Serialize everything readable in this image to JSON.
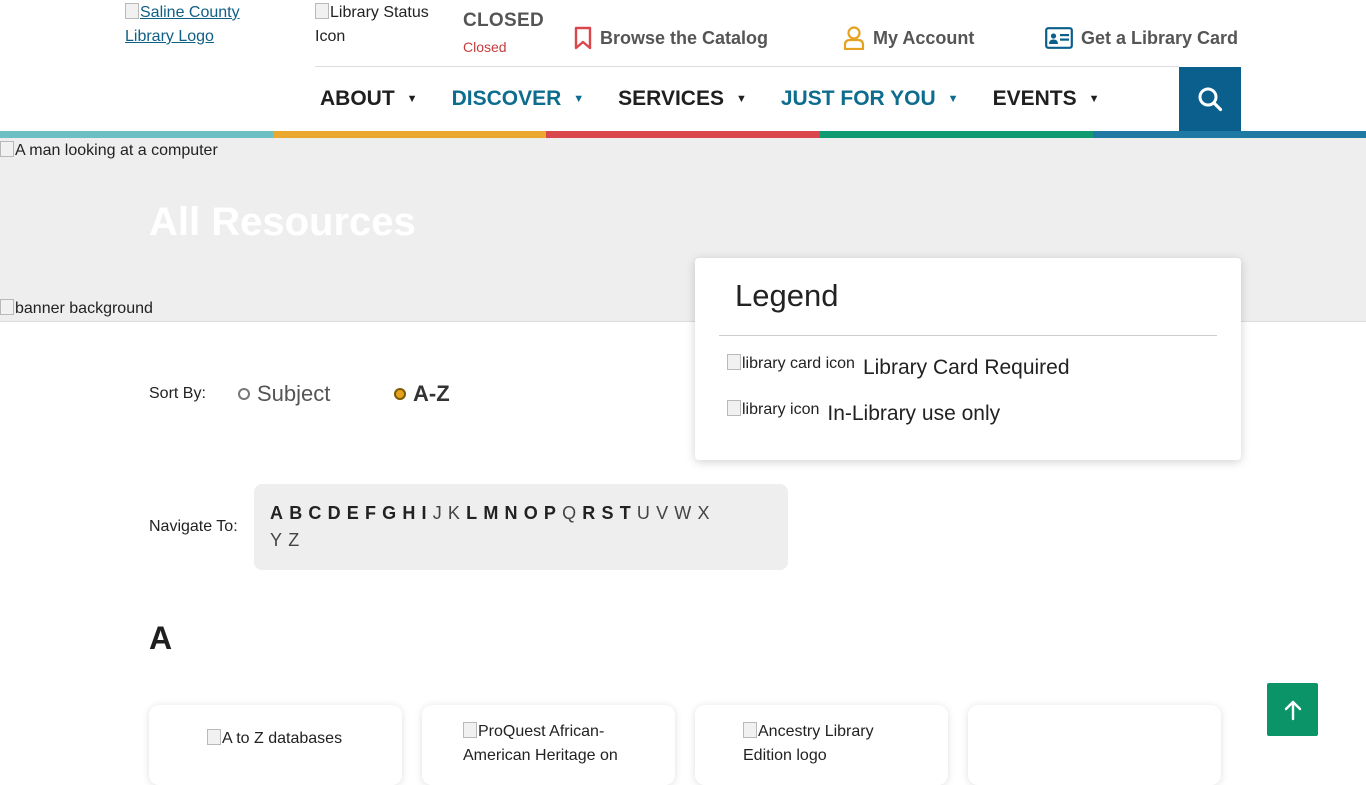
{
  "header": {
    "logo_alt": "Saline County Library Logo",
    "status_icon_alt": "Library Status Icon",
    "status": "CLOSED",
    "status_detail": "Closed",
    "links": {
      "catalog": "Browse the Catalog",
      "account": "My Account",
      "library_card": "Get a Library Card"
    }
  },
  "nav": {
    "items": [
      {
        "label": "ABOUT"
      },
      {
        "label": "DISCOVER"
      },
      {
        "label": "SERVICES"
      },
      {
        "label": "JUST FOR YOU"
      },
      {
        "label": "EVENTS"
      }
    ],
    "search_icon": "search-icon"
  },
  "colors": {
    "accent_blue": "#0b5f8c",
    "nav_teal": "#0e6c8e",
    "status_red": "#c43d3d",
    "bar_teal": "#6cc0c3",
    "bar_gold": "#eaa82f",
    "bar_red": "#d9474c",
    "bar_green": "#0f9a71",
    "bar_blue": "#1f7aa3",
    "radio_selected": "#e5a21f",
    "to_top_green": "#0a9467"
  },
  "banner": {
    "image_alt": "A man looking at a computer",
    "title": "All Resources",
    "background_alt": "banner background"
  },
  "legend": {
    "title": "Legend",
    "items": [
      {
        "icon_alt": "library card icon",
        "label": "Library Card Required"
      },
      {
        "icon_alt": "library icon",
        "label": "In-Library use only"
      }
    ]
  },
  "sort": {
    "label": "Sort By:",
    "options": [
      {
        "label": "Subject",
        "selected": false
      },
      {
        "label": "A-Z",
        "selected": true
      }
    ]
  },
  "navigate": {
    "label": "Navigate To:",
    "letters": [
      "A",
      "B",
      "C",
      "D",
      "E",
      "F",
      "G",
      "H",
      "I",
      "J",
      "K",
      "L",
      "M",
      "N",
      "O",
      "P",
      "Q",
      "R",
      "S",
      "T",
      "U",
      "V",
      "W",
      "X",
      "Y",
      "Z"
    ],
    "linked": [
      "A",
      "B",
      "C",
      "D",
      "E",
      "F",
      "G",
      "H",
      "I",
      "L",
      "M",
      "N",
      "O",
      "P",
      "R",
      "S",
      "T"
    ]
  },
  "section": {
    "letter": "A",
    "cards": [
      {
        "image_alt": "A to Z databases"
      },
      {
        "image_alt": "ProQuest African-American Heritage on"
      },
      {
        "image_alt": "Ancestry Library Edition logo"
      },
      {
        "image_alt": ""
      }
    ]
  },
  "back_to_top_icon": "arrow-up-icon"
}
